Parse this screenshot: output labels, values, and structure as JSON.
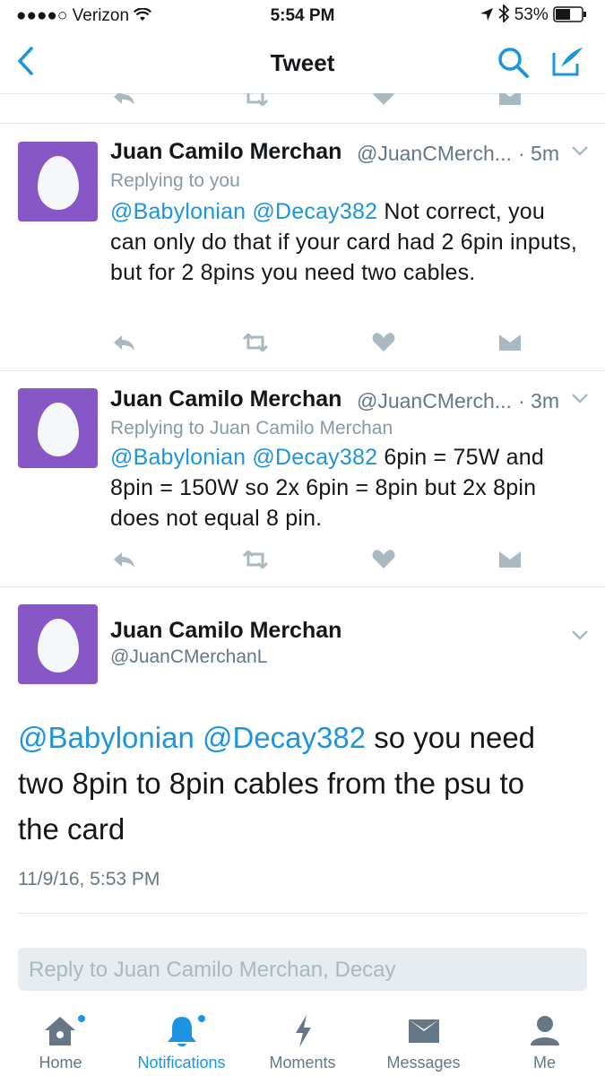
{
  "status_bar": {
    "carrier": "Verizon",
    "time": "5:54 PM",
    "battery": "53%"
  },
  "nav": {
    "title": "Tweet",
    "back_icon": "chevron-left-icon",
    "search_icon": "search-icon",
    "compose_icon": "compose-icon"
  },
  "tweets": [
    {
      "name": "Juan Camilo Merchan",
      "handle": "@JuanCMerch...",
      "time": "· 5m",
      "replying": "Replying to you",
      "mentions": "@Babylonian @Decay382",
      "text": " Not correct, you can only do that if your card had 2 6pin inputs, but for 2 8pins you need two cables."
    },
    {
      "name": "Juan Camilo Merchan",
      "handle": "@JuanCMerch...",
      "time": "· 3m",
      "replying": "Replying to Juan Camilo Merchan",
      "mentions": "@Babylonian @Decay382",
      "text": " 6pin = 75W and 8pin = 150W so 2x 6pin = 8pin but 2x 8pin does not equal 8 pin."
    }
  ],
  "main_tweet": {
    "name": "Juan Camilo Merchan",
    "handle": "@JuanCMerchanL",
    "mentions": "@Babylonian @Decay382",
    "text": " so you need two 8pin to 8pin cables from the psu to the card",
    "timestamp": "11/9/16, 5:53 PM"
  },
  "reply": {
    "placeholder": "Reply to Juan Camilo Merchan, Decay"
  },
  "tabs": [
    {
      "label": "Home",
      "icon": "home-icon",
      "active": false,
      "dot": true
    },
    {
      "label": "Notifications",
      "icon": "bell-icon",
      "active": true,
      "dot": true
    },
    {
      "label": "Moments",
      "icon": "lightning-icon",
      "active": false,
      "dot": false
    },
    {
      "label": "Messages",
      "icon": "envelope-icon",
      "active": false,
      "dot": false
    },
    {
      "label": "Me",
      "icon": "person-icon",
      "active": false,
      "dot": false
    }
  ],
  "colors": {
    "accent": "#1b95e0",
    "avatar": "#8757c5",
    "muted": "#657786",
    "action": "#aab8c2"
  }
}
